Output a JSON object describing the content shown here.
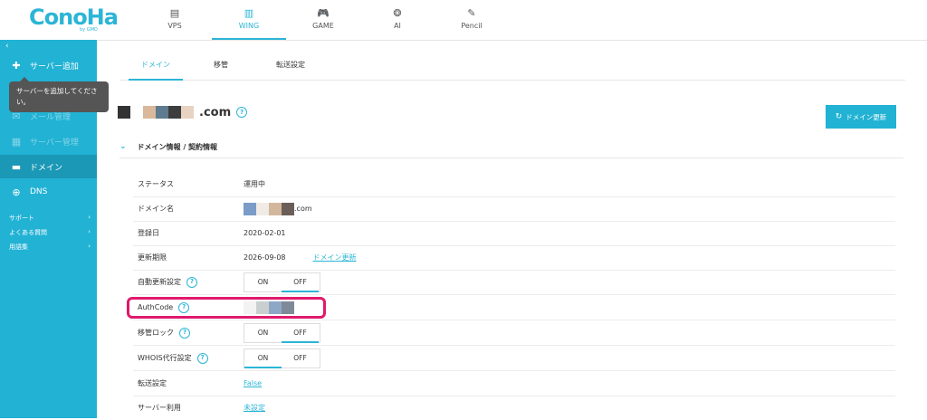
{
  "brand": {
    "logo": "ConoHa",
    "logo_sub": "by GMO"
  },
  "nav": [
    {
      "label": "VPS",
      "icon": "server-icon",
      "glyph": "▤",
      "active": false
    },
    {
      "label": "WING",
      "icon": "building-icon",
      "glyph": "▥",
      "active": true
    },
    {
      "label": "GAME",
      "icon": "gamepad-icon",
      "glyph": "🎮",
      "active": false
    },
    {
      "label": "AI",
      "icon": "brain-icon",
      "glyph": "❂",
      "active": false
    },
    {
      "label": "Pencil",
      "icon": "pencil-icon",
      "glyph": "✎",
      "active": false
    }
  ],
  "sidebar": {
    "collapse": "‹",
    "items": [
      {
        "label": "サーバー追加",
        "icon": "plus-icon",
        "glyph": "✚"
      },
      {
        "label": "メール管理",
        "icon": "mail-icon",
        "glyph": "✉"
      },
      {
        "label": "サーバー管理",
        "icon": "server-icon",
        "glyph": "▦"
      },
      {
        "label": "ドメイン",
        "icon": "domain-icon",
        "glyph": "▬"
      },
      {
        "label": "DNS",
        "icon": "globe-icon",
        "glyph": "⊕"
      }
    ],
    "links": [
      {
        "label": "サポート",
        "arrow": "›"
      },
      {
        "label": "よくある質問",
        "arrow": "›"
      },
      {
        "label": "用語集",
        "arrow": "›"
      }
    ],
    "tooltip": "サーバーを追加してください。"
  },
  "tabs": [
    "ドメイン",
    "移管",
    "転送設定"
  ],
  "domain": {
    "suffix": ".com",
    "help": "?",
    "renew_button": "ドメイン更新",
    "renew_icon": "↻",
    "swatches": [
      "#333333",
      "#ffffff",
      "#d9b89c",
      "#5e7b8f",
      "#3d3d3d",
      "#e8d2c2"
    ]
  },
  "section": {
    "chevron": "⌄",
    "title": "ドメイン情報 / 契約情報"
  },
  "rows": {
    "status": {
      "label": "ステータス",
      "value": "運用中"
    },
    "domain_name": {
      "label": "ドメイン名",
      "suffix": ".com",
      "swatches": [
        "#7a9cc6",
        "#f0ebe4",
        "#d3b79d",
        "#6b5e58"
      ]
    },
    "registered": {
      "label": "登録日",
      "value": "2020-02-01"
    },
    "expiry": {
      "label": "更新期限",
      "value": "2026-09-08",
      "link": "ドメイン更新"
    },
    "auto_renew": {
      "label": "自動更新設定",
      "on": "ON",
      "off": "OFF",
      "selected": "OFF"
    },
    "authcode": {
      "label": "AuthCode",
      "swatches": [
        "#f2f2f2",
        "#c9cfcf",
        "#8fa7c7",
        "#7f8a99"
      ]
    },
    "transfer_lock": {
      "label": "移管ロック",
      "on": "ON",
      "off": "OFF",
      "selected": "OFF"
    },
    "whois": {
      "label": "WHOIS代行設定",
      "on": "ON",
      "off": "OFF",
      "selected": "ON"
    },
    "forwarding": {
      "label": "転送設定",
      "value": "False"
    },
    "server_use": {
      "label": "サーバー利用",
      "value": "未設定"
    }
  },
  "colors": {
    "accent": "#21b2d4",
    "highlight": "#e0196c"
  }
}
